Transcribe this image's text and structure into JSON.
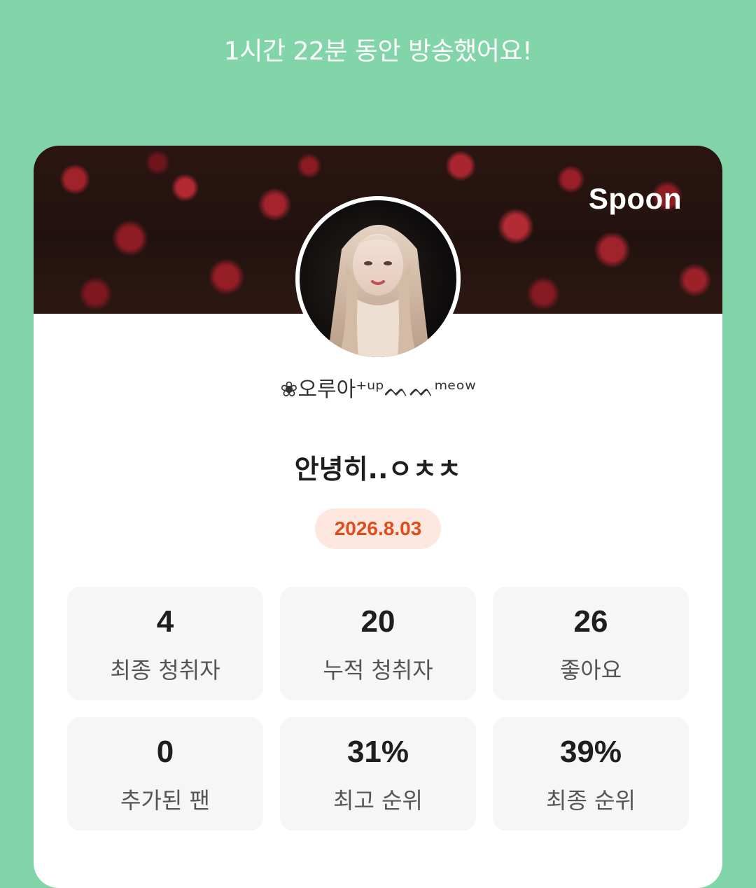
{
  "header": {
    "duration_text": "1시간 22분 동안 방송했어요!"
  },
  "card": {
    "brand": "Spoon",
    "nickname": "❀오루아⁺ᵘᵖᨓᨓᵐᵉᵒʷ",
    "title": "안녕히..ㅇㅊㅊ",
    "date": "2026.8.03"
  },
  "stats": [
    {
      "value": "4",
      "label": "최종 청취자"
    },
    {
      "value": "20",
      "label": "누적 청취자"
    },
    {
      "value": "26",
      "label": "좋아요"
    },
    {
      "value": "0",
      "label": "추가된 팬"
    },
    {
      "value": "31%",
      "label": "최고 순위"
    },
    {
      "value": "39%",
      "label": "최종 순위"
    }
  ],
  "colors": {
    "background": "#82d5a8",
    "card": "#ffffff",
    "date_badge_bg": "#fde7df",
    "date_badge_text": "#dd4e1f",
    "tile_bg": "#f6f6f6"
  },
  "icons": {
    "avatar": "profile-photo",
    "cover": "rose-cover-photo"
  }
}
